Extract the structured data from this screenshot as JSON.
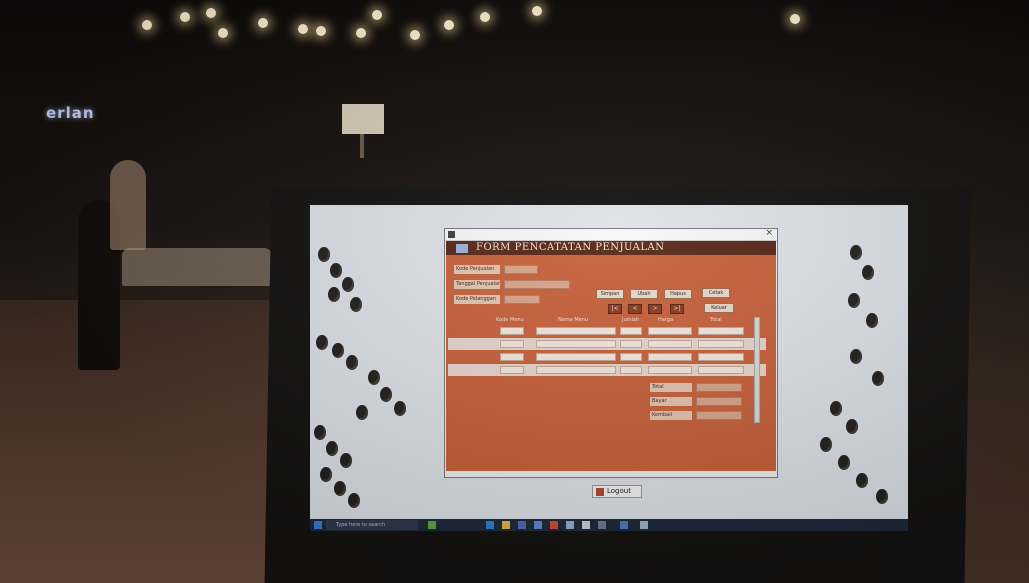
{
  "scene": {
    "background_sign": "erlan",
    "colors": {
      "form_background": "#c8623c",
      "header_band": "#5a2818",
      "taskbar": "#1f2a3a"
    }
  },
  "app": {
    "form_title": "FORM PENCATATAN PENJUALAN",
    "fields": [
      {
        "label": "Kode Penjualan",
        "value": ""
      },
      {
        "label": "Tanggal Penjualan",
        "value": ""
      },
      {
        "label": "Kode Pelanggan",
        "value": ""
      }
    ],
    "buttons": {
      "simpan": "Simpan",
      "ubah": "Ubah",
      "hapus": "Hapus",
      "cetak": "Cetak",
      "keluar": "Keluar"
    },
    "nav_buttons": [
      "|<",
      "<",
      ">",
      ">|"
    ],
    "table": {
      "headers": [
        "Kode Menu",
        "Nama Menu",
        "Jumlah",
        "Harga",
        "Total"
      ],
      "rows": [
        {
          "kode": "",
          "nama": "",
          "jumlah": "",
          "harga": "",
          "total": ""
        },
        {
          "kode": "",
          "nama": "",
          "jumlah": "",
          "harga": "",
          "total": ""
        },
        {
          "kode": "",
          "nama": "",
          "jumlah": "",
          "harga": "",
          "total": ""
        },
        {
          "kode": "",
          "nama": "",
          "jumlah": "",
          "harga": "",
          "total": ""
        }
      ]
    },
    "totals": {
      "total_label": "Total",
      "bayar_label": "Bayar",
      "kembali_label": "Kembali"
    },
    "logout_label": "Logout"
  },
  "taskbar": {
    "search_placeholder": "Type here to search",
    "tray_text": ""
  }
}
